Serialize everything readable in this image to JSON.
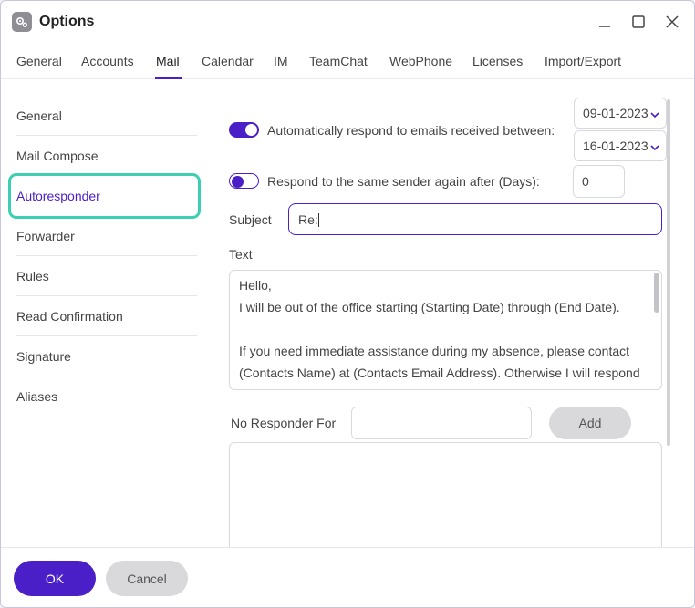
{
  "window": {
    "title": "Options",
    "app_icon": "gear-icon"
  },
  "window_controls": {
    "minimize": "minimize-icon",
    "maximize": "maximize-icon",
    "close": "close-icon"
  },
  "tabs": [
    {
      "label": "General"
    },
    {
      "label": "Accounts"
    },
    {
      "label": "Mail",
      "active": true
    },
    {
      "label": "Calendar"
    },
    {
      "label": "IM"
    },
    {
      "label": "TeamChat"
    },
    {
      "label": "WebPhone"
    },
    {
      "label": "Licenses"
    },
    {
      "label": "Import/Export"
    }
  ],
  "sidebar": {
    "items": [
      {
        "label": "General"
      },
      {
        "label": "Mail Compose"
      },
      {
        "label": "Autoresponder",
        "active": true
      },
      {
        "label": "Forwarder"
      },
      {
        "label": "Rules"
      },
      {
        "label": "Read Confirmation"
      },
      {
        "label": "Signature"
      },
      {
        "label": "Aliases"
      }
    ]
  },
  "autoresponder": {
    "auto_respond": {
      "enabled": true,
      "label": "Automatically respond to emails received between:"
    },
    "date_from": "09-01-2023",
    "date_to": "16-01-2023",
    "respond_again": {
      "enabled": false,
      "label": "Respond to the same sender again after (Days):",
      "days": "0"
    },
    "subject": {
      "label": "Subject",
      "value": "Re:"
    },
    "text": {
      "label": "Text",
      "lines": [
        "Hello,",
        "I will be out of the office starting (Starting Date) through (End Date).",
        "",
        "If you need immediate assistance during my absence, please contact",
        "(Contacts Name) at (Contacts Email Address). Otherwise I will respond"
      ]
    },
    "no_responder": {
      "label": "No Responder For",
      "value": "",
      "add_label": "Add"
    }
  },
  "footer": {
    "ok_label": "OK",
    "cancel_label": "Cancel"
  },
  "colors": {
    "accent": "#4a1fc7",
    "highlight": "#3dcfb4"
  }
}
